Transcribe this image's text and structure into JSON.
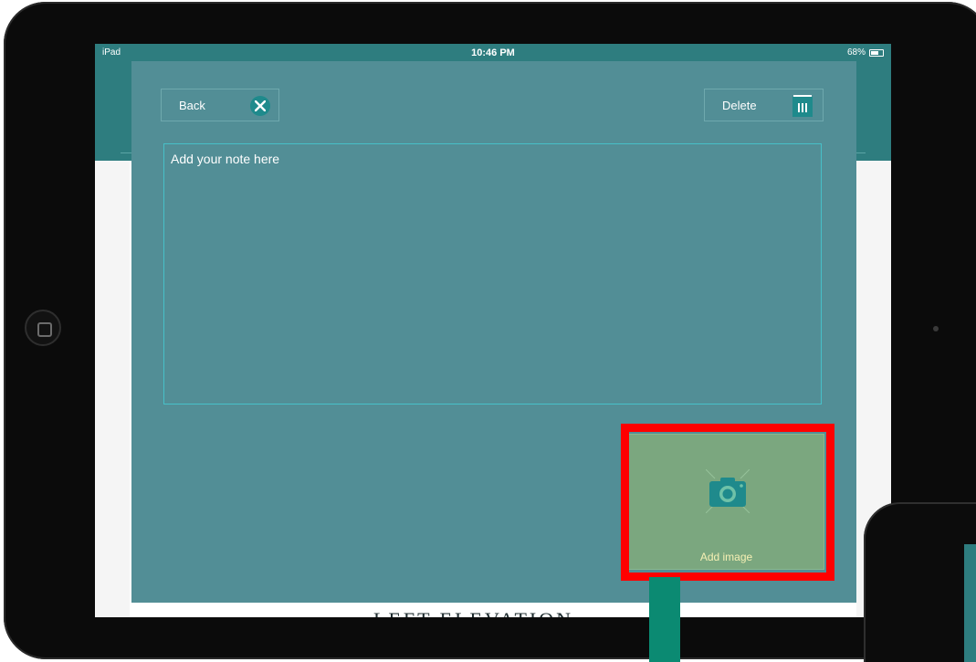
{
  "status_bar": {
    "device": "iPad",
    "time": "10:46 PM",
    "battery_label": "68%",
    "battery_level": 0.68
  },
  "toolbar": {
    "back_label": "Back",
    "delete_label": "Delete"
  },
  "note": {
    "placeholder": "Add your note here",
    "value": ""
  },
  "add_image": {
    "label": "Add image"
  },
  "background": {
    "caption": "LEFT ELEVATION"
  },
  "colors": {
    "modal_bg": "#528e96",
    "accent": "#1f8a8c",
    "add_image_bg": "#7ba77f",
    "highlight": "#ff0000",
    "pointer": "#0b8a72"
  },
  "icons": {
    "back": "close-icon",
    "delete": "trash-icon",
    "add_image": "camera-icon"
  }
}
